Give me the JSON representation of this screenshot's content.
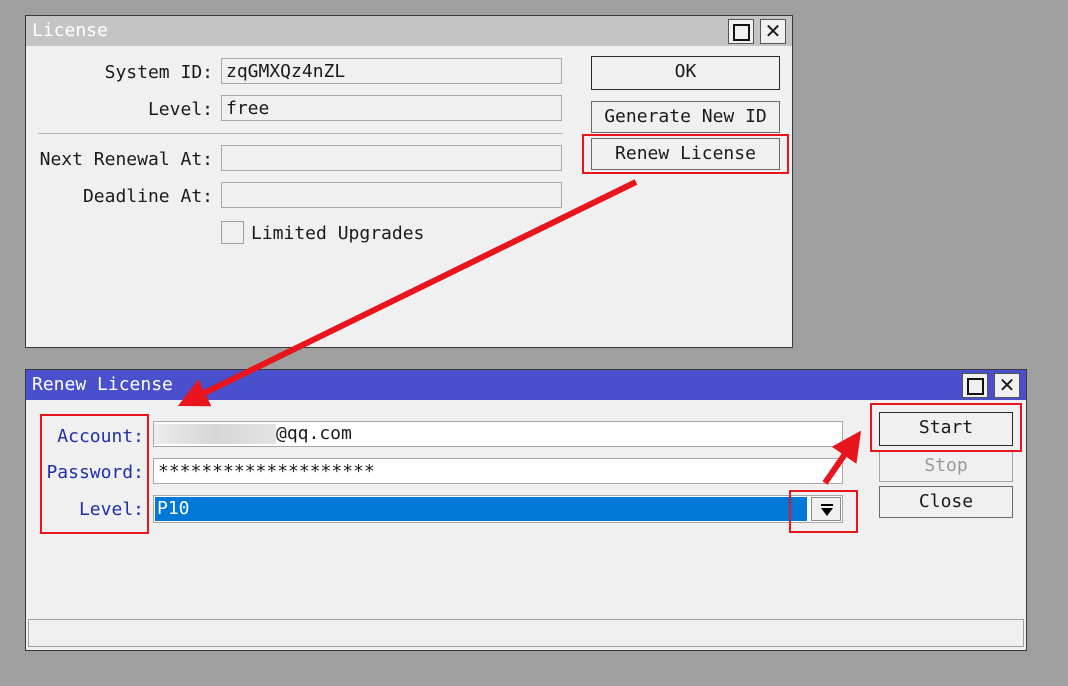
{
  "license_window": {
    "title": "License",
    "system_id_label": "System ID:",
    "system_id_value": "zqGMXQz4nZL",
    "level_label": "Level:",
    "level_value": "free",
    "next_renewal_label": "Next Renewal At:",
    "next_renewal_value": "",
    "deadline_label": "Deadline At:",
    "deadline_value": "",
    "limited_upgrades_label": "Limited Upgrades",
    "ok_label": "OK",
    "generate_label": "Generate New ID",
    "renew_label": "Renew License"
  },
  "renew_window": {
    "title": "Renew License",
    "account_label": "Account:",
    "account_value": "@qq.com",
    "password_label": "Password:",
    "password_value": "********************",
    "level_label": "Level:",
    "level_value": "P10",
    "start_label": "Start",
    "stop_label": "Stop",
    "close_label": "Close"
  },
  "colors": {
    "highlight": "#e8141e",
    "renew_titlebar": "#4a4fcc",
    "selection": "#0078d7"
  }
}
